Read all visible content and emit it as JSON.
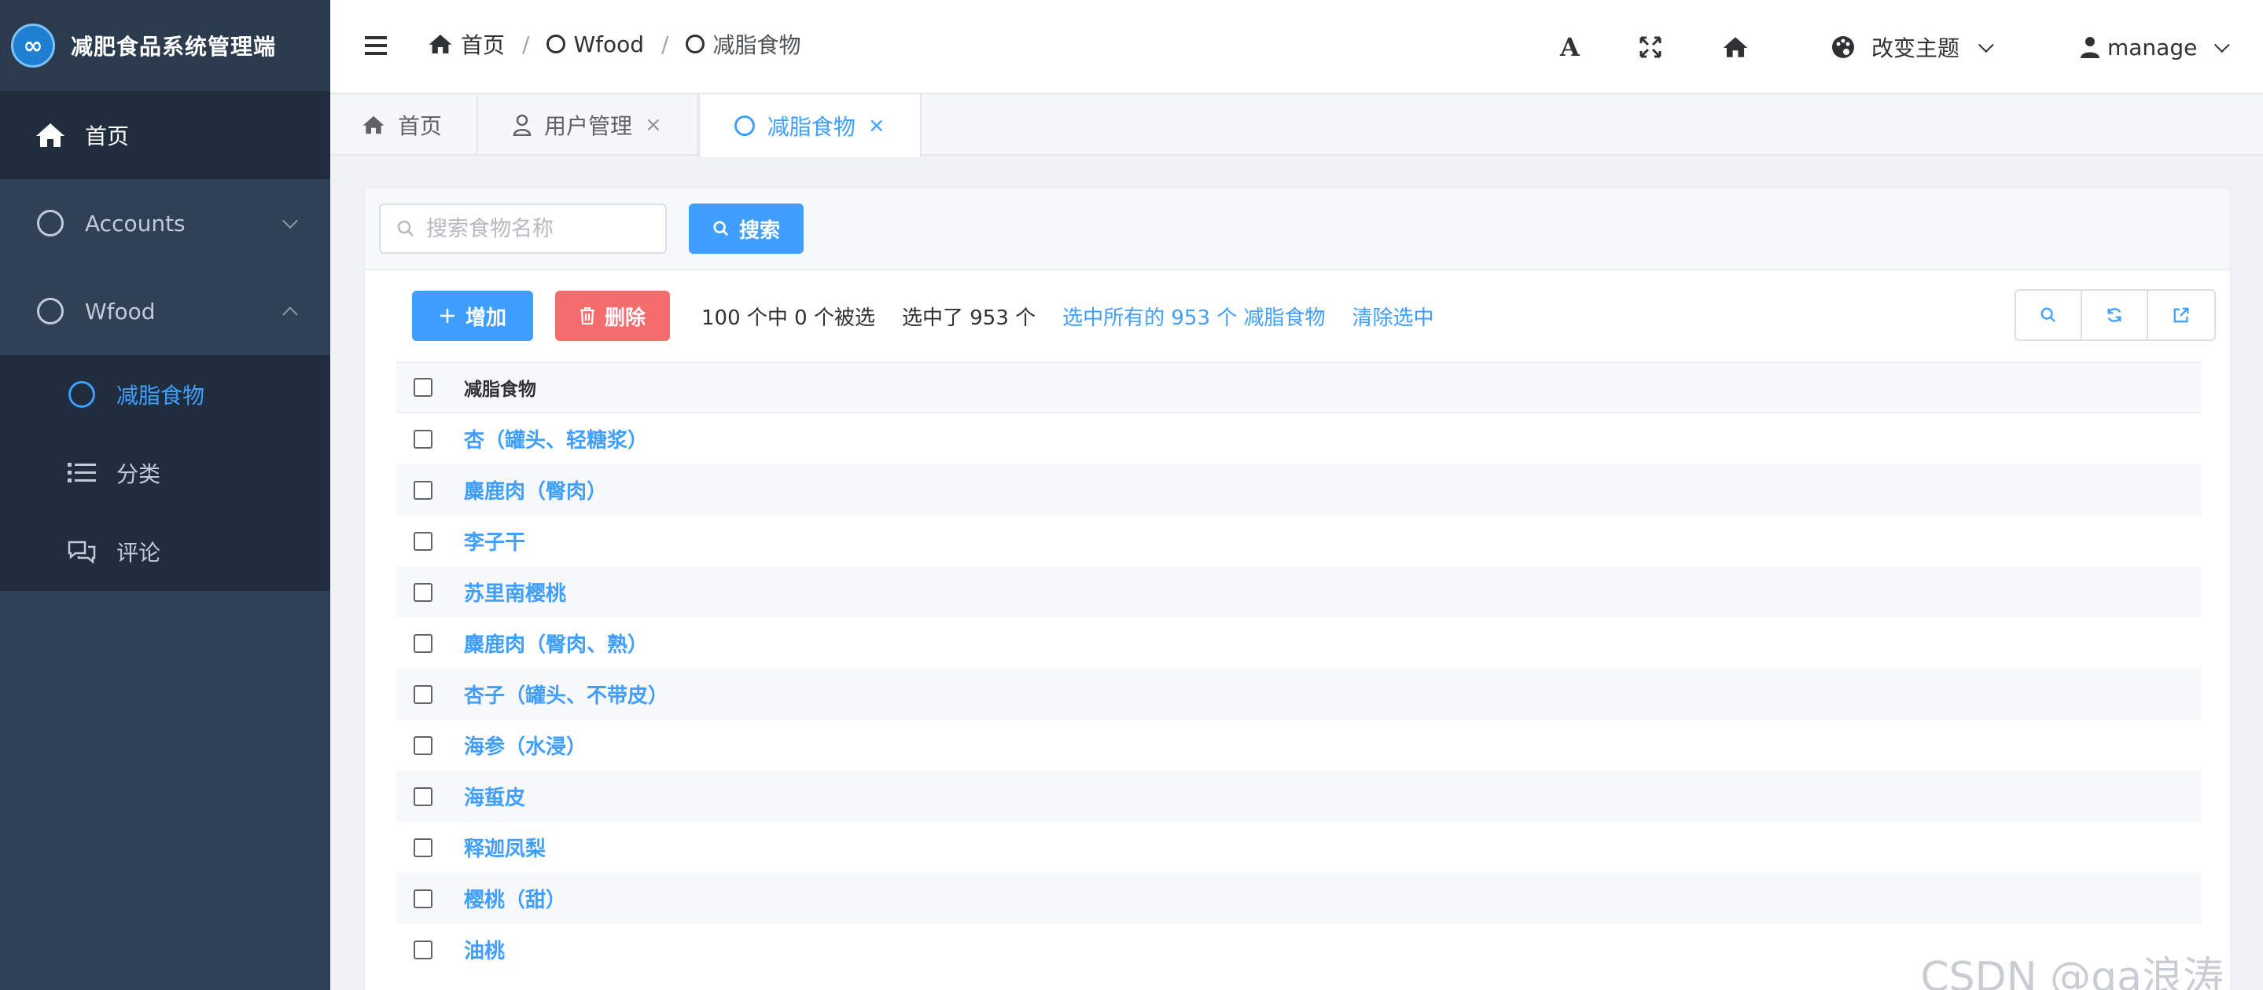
{
  "app": {
    "title": "减肥食品系统管理端",
    "logo_glyph": "∞"
  },
  "sidebar": {
    "items": [
      {
        "label": "首页",
        "icon": "home-icon"
      },
      {
        "label": "Accounts",
        "icon": "circle-icon"
      },
      {
        "label": "Wfood",
        "icon": "circle-icon"
      }
    ],
    "submenu": [
      {
        "label": "减脂食物",
        "icon": "circle-icon"
      },
      {
        "label": "分类",
        "icon": "list-icon"
      },
      {
        "label": "评论",
        "icon": "comments-icon"
      }
    ]
  },
  "header": {
    "breadcrumb": [
      "首页",
      "Wfood",
      "减脂食物"
    ],
    "separator": "/",
    "font_icon": "A",
    "theme_label": "改变主题",
    "user_label": "manage"
  },
  "tabs": [
    {
      "label": "首页"
    },
    {
      "label": "用户管理",
      "close": "×"
    },
    {
      "label": "减脂食物",
      "close": "×"
    }
  ],
  "search": {
    "placeholder": "搜索食物名称",
    "value": "",
    "button_label": "搜索"
  },
  "actions": {
    "add_label": "增加",
    "delete_label": "删除",
    "selection_info": "100 个中 0 个被选",
    "selected_count": "选中了 953 个",
    "select_all_link": "选中所有的 953 个 减脂食物",
    "clear_link": "清除选中"
  },
  "table": {
    "header": "减脂食物",
    "rows": [
      "杏（罐头、轻糖浆）",
      "麋鹿肉（臀肉）",
      "李子干",
      "苏里南樱桃",
      "麋鹿肉（臀肉、熟）",
      "杏子（罐头、不带皮）",
      "海参（水浸）",
      "海蜇皮",
      "释迦凤梨",
      "樱桃（甜）",
      "油桃"
    ]
  },
  "watermark": "CSDN @qa浪涛",
  "colors": {
    "primary": "#409eff",
    "danger": "#f56c6c",
    "sidebar_bg": "#304156",
    "sidebar_dark": "#1f2d3d"
  }
}
